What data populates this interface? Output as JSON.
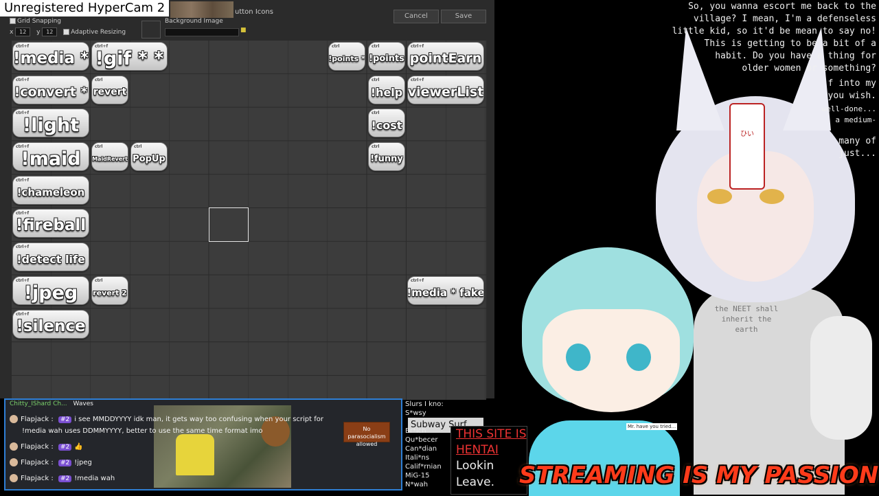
{
  "hypercam": {
    "label": "Unregistered HyperCam 2"
  },
  "editor": {
    "header_title": "utton Icons",
    "cancel_label": "Cancel",
    "save_label": "Save",
    "grid_snapping_label": "Grid Snapping",
    "x_label": "x",
    "x_value": "12",
    "y_label": "y",
    "y_value": "12",
    "adaptive_resizing_label": "Adaptive Resizing",
    "background_image_label": "Background Image"
  },
  "buttons": [
    {
      "label": "!media *"
    },
    {
      "label": "!gif * *"
    },
    {
      "label": "!points *"
    },
    {
      "label": "!points"
    },
    {
      "label": "pointEarn"
    },
    {
      "label": "!convert *"
    },
    {
      "label": "revert"
    },
    {
      "label": "!help"
    },
    {
      "label": "viewerList"
    },
    {
      "label": "!light"
    },
    {
      "label": "!cost"
    },
    {
      "label": "!maid"
    },
    {
      "label": "MaidRevert"
    },
    {
      "label": "PopUp"
    },
    {
      "label": "!funny"
    },
    {
      "label": "!chameleon"
    },
    {
      "label": "!fireball"
    },
    {
      "label": "!detect life"
    },
    {
      "label": "!jpeg"
    },
    {
      "label": "revert 2"
    },
    {
      "label": "!media * fake"
    },
    {
      "label": "!silence"
    }
  ],
  "chat": {
    "top_user": "Chitty_IShard Ch...",
    "top_text": "Waves",
    "messages": [
      {
        "user": "Flapjack",
        "badge": "#2",
        "text": "i see MMDDYYYY idk man, it gets way too confusing when your script for"
      },
      {
        "user": "",
        "badge": "",
        "text": "!media wah uses DDMMYYYY, better to use the same time format imo"
      },
      {
        "user": "Flapjack",
        "badge": "#2",
        "text": "👍"
      },
      {
        "user": "Flapjack",
        "badge": "#2",
        "text": "!jpeg"
      },
      {
        "user": "Flapjack",
        "badge": "#2",
        "text": "!media wah"
      }
    ],
    "no_parasocialism": "No parasocialism allowed"
  },
  "slurs": {
    "title": "Slurs I kno:",
    "items": [
      "S*wsy",
      "Br*ich",
      "Qu*becer",
      "Can*dian",
      "Itali*ns",
      "Calif*rnian",
      "MiG-15",
      "N*wah"
    ],
    "subway": "Subway Surf"
  },
  "ad": {
    "line1": "THIS SITE IS",
    "line2": "HENTAI",
    "line3": "Lookin",
    "line4": "Leave."
  },
  "story": {
    "lines": [
      "So, you wanna escort me back to the",
      "village? I mean, I'm a defenseless",
      "little kid, so it'd be mean to say no!",
      "This is getting to be a bit of a",
      "habit. Do you have a thing for",
      "older women or something?",
      "f into my",
      "you wish.",
      "well-done...",
      "a medium-",
      "many of",
      "just..."
    ]
  },
  "scene": {
    "shirt_text": "the NEET shall inherit the earth",
    "tag_text": "ひい",
    "banner": "STREAMING IS MY PASSION"
  },
  "colors": {
    "accent_red": "#ff3b1a",
    "chat_border": "#2e7fd6",
    "badge": "#7a4fd1"
  }
}
